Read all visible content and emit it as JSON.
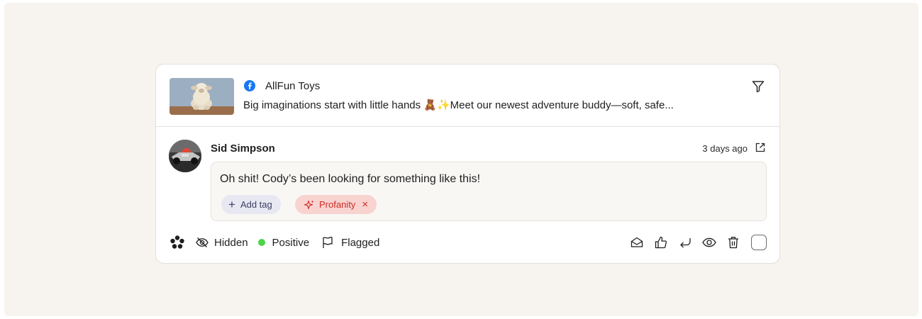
{
  "post": {
    "author": "AllFun Toys",
    "caption": "Big imaginations start with little hands 🧸✨Meet our newest adventure buddy—soft, safe...",
    "platform_icon": "facebook-icon",
    "filter_icon": "filter-icon"
  },
  "comment": {
    "author": "Sid Simpson",
    "time": "3 days ago",
    "text": "Oh shit! Cody’s been looking for something like this!",
    "tags": {
      "add_label": "Add tag",
      "profanity_label": "Profanity"
    }
  },
  "status": {
    "hidden_label": "Hidden",
    "sentiment_label": "Positive",
    "sentiment_color": "#4cd44a",
    "flag_label": "Flagged"
  },
  "actions": [
    "mark-read-icon",
    "like-icon",
    "reply-icon",
    "view-icon",
    "delete-icon",
    "select-checkbox"
  ],
  "colors": {
    "background": "#f7f3ee",
    "tag_add_bg": "#e7e8f1",
    "tag_profanity_bg": "#f8d3d0",
    "tag_profanity_text": "#cf2b25",
    "facebook_blue": "#1877f2"
  }
}
